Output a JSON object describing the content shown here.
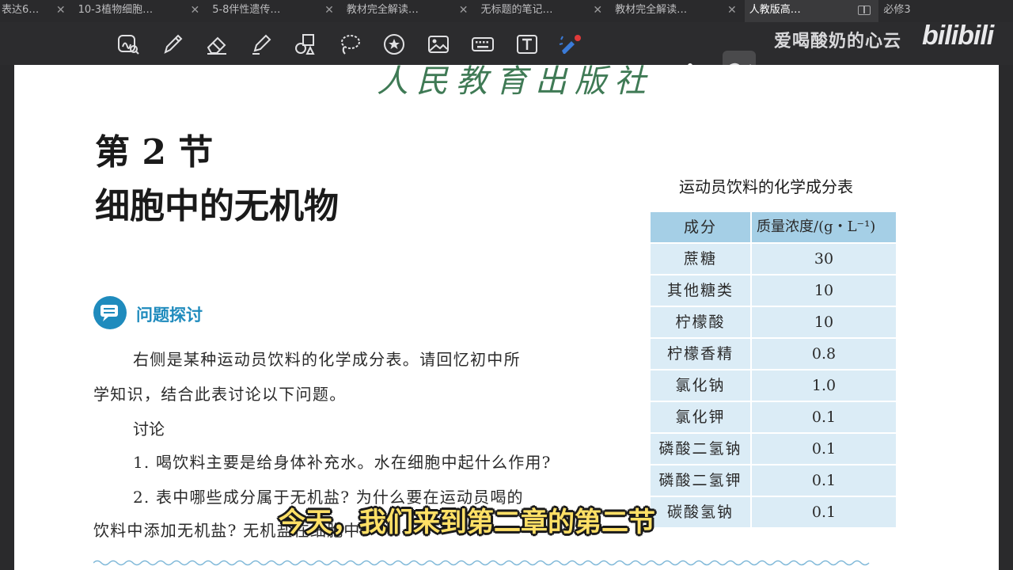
{
  "tabs": [
    {
      "label": "表达6…",
      "active": false
    },
    {
      "label": "10-3植物细胞…",
      "active": false
    },
    {
      "label": "5-8伴性遗传…",
      "active": false
    },
    {
      "label": "教材完全解读…",
      "active": false
    },
    {
      "label": "无标题的笔记…",
      "active": false
    },
    {
      "label": "教材完全解读…",
      "active": false
    },
    {
      "label": "人教版高…",
      "active": true
    },
    {
      "label": "必修3",
      "active": false
    }
  ],
  "tab_close_glyph": "✕",
  "toolbar": {
    "tools": [
      "lasso-zoom-icon",
      "pen-icon",
      "eraser-icon",
      "highlighter-icon",
      "shapes-icon",
      "lasso-icon",
      "sticker-icon",
      "image-icon",
      "keyboard-icon",
      "text-box-icon",
      "laser-pointer-icon"
    ],
    "uploader": "爱喝酸奶的心云",
    "platform_logo": "bilibili"
  },
  "page": {
    "publisher": "人民教育出版社",
    "section_number": "第 2 节",
    "section_title": "细胞中的无机物",
    "question_heading": "问题探讨",
    "intro_line1": "右侧是某种运动员饮料的化学成分表。请回忆初中所",
    "intro_line2": "学知识，结合此表讨论以下问题。",
    "discussion_label": "讨论",
    "q1": "1.   喝饮料主要是给身体补充水。水在细胞中起什么作用?",
    "q2": "2.   表中哪些成分属于无机盐? 为什么要在运动员喝的",
    "q2_cont": "饮料中添加无机盐? 无机盐在细胞中"
  },
  "table": {
    "caption": "运动员饮料的化学成分表",
    "headers": [
      "成分",
      "质量浓度/(g・L⁻¹)"
    ],
    "rows": [
      [
        "蔗糖",
        "30"
      ],
      [
        "其他糖类",
        "10"
      ],
      [
        "柠檬酸",
        "10"
      ],
      [
        "柠檬香精",
        "0.8"
      ],
      [
        "氯化钠",
        "1.0"
      ],
      [
        "氯化钾",
        "0.1"
      ],
      [
        "磷酸二氢钠",
        "0.1"
      ],
      [
        "磷酸二氢钾",
        "0.1"
      ],
      [
        "碳酸氢钠",
        "0.1"
      ]
    ]
  },
  "subtitle": "今天，我们来到第二章的第二节",
  "colors": {
    "accent": "#1f8bbd",
    "table_header": "#a5cfe6",
    "table_cell": "#dbecf6",
    "subtitle": "#ffe066",
    "publisher": "#3f7a55"
  }
}
